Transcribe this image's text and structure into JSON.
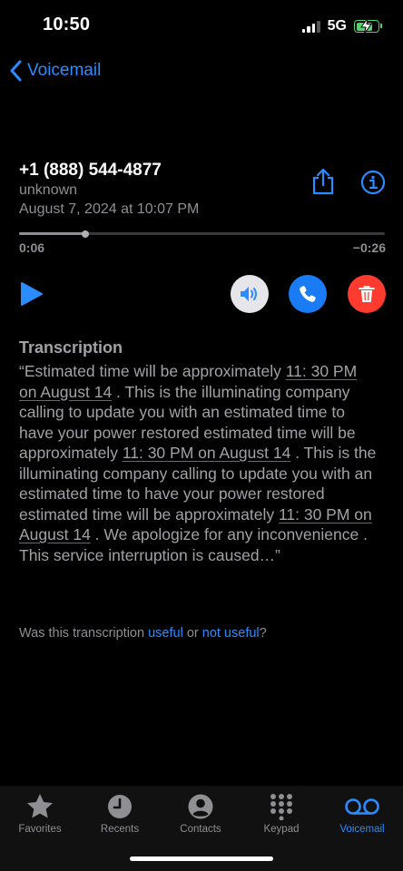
{
  "status_bar": {
    "time": "10:50",
    "network": "5G",
    "battery_percent": 75,
    "battery_charging": true
  },
  "nav": {
    "back_label": "Voicemail"
  },
  "voicemail": {
    "caller_number": "+1 (888) 544-4877",
    "caller_label": "unknown",
    "date": "August 7, 2024 at 10:07 PM",
    "elapsed": "0:06",
    "remaining": "−0:26",
    "progress_percent": 18
  },
  "transcription": {
    "heading": "Transcription",
    "segments": [
      {
        "text": "“Estimated time will be approximately ",
        "underline": false
      },
      {
        "text": "11: 30 PM on August 14",
        "underline": true
      },
      {
        "text": " . This is the illuminating company calling to update you with an estimated time to have your power restored estimated time will be approximately ",
        "underline": false
      },
      {
        "text": "11: 30 PM on August 14",
        "underline": true
      },
      {
        "text": " . This is the illuminating company calling to update you with an estimated time to have your power restored estimated time will be approximately ",
        "underline": false
      },
      {
        "text": "11: 30 PM on August 14",
        "underline": true
      },
      {
        "text": " . We apologize for any inconvenience . This service interruption is caused…”",
        "underline": false
      }
    ]
  },
  "feedback": {
    "prefix": "Was this transcription ",
    "useful": "useful",
    "middle": " or ",
    "not_useful": "not useful",
    "suffix": "?"
  },
  "tabs": [
    {
      "label": "Favorites",
      "icon": "star-icon",
      "active": false
    },
    {
      "label": "Recents",
      "icon": "clock-icon",
      "active": false
    },
    {
      "label": "Contacts",
      "icon": "person-icon",
      "active": false
    },
    {
      "label": "Keypad",
      "icon": "keypad-icon",
      "active": false
    },
    {
      "label": "Voicemail",
      "icon": "voicemail-icon",
      "active": true
    }
  ],
  "colors": {
    "accent": "#2a8cff",
    "delete": "#ff3b30",
    "call": "#1a7cf5",
    "battery": "#4cd964"
  }
}
